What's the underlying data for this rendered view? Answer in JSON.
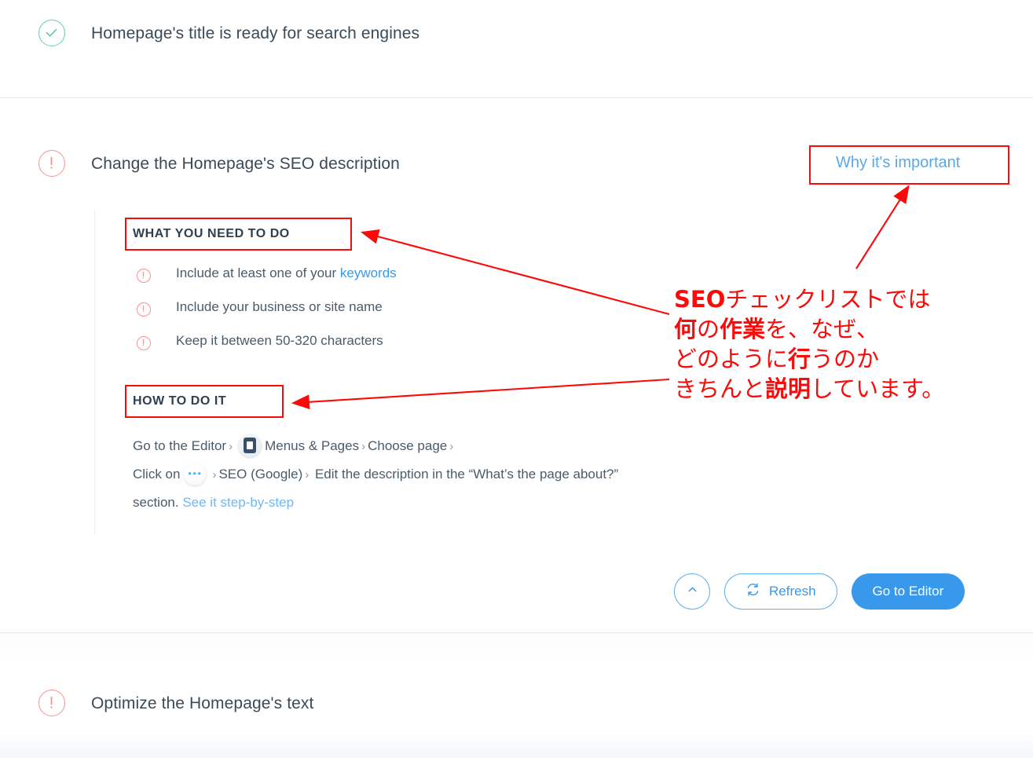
{
  "colors": {
    "accent_blue": "#3899ec",
    "link_blue": "#74b7f0",
    "ok_green": "#64cfa0",
    "alert_pink": "#f79294",
    "annotation_red": "#fb0a0a",
    "text_dark": "#3b4a57",
    "text_body": "#4a5b69",
    "divider": "#e8ecef"
  },
  "rows": [
    {
      "id": "homepage-title",
      "status_icon": "check-circle-icon",
      "status": "ok",
      "title": "Homepage's title is ready for search engines"
    },
    {
      "id": "seo-description",
      "status_icon": "alert-circle-icon",
      "status": "alert",
      "title": "Change the Homepage's SEO description",
      "why_link": "Why it's important"
    },
    {
      "id": "homepage-text",
      "status_icon": "alert-circle-icon",
      "status": "alert",
      "title": "Optimize the Homepage's text"
    }
  ],
  "detail": {
    "heading_what": "WHAT YOU NEED TO DO",
    "heading_how": "HOW TO DO IT",
    "checklist": [
      {
        "icon": "alert-circle-icon",
        "text_before": "Include at least one of your ",
        "link": "keywords",
        "text_after": ""
      },
      {
        "icon": "alert-circle-icon",
        "text_before": "Include your business or site name",
        "link": "",
        "text_after": ""
      },
      {
        "icon": "alert-circle-icon",
        "text_before": "Keep it between 50-320 characters",
        "link": "",
        "text_after": ""
      }
    ],
    "howto": {
      "part1": "Go to the Editor",
      "chev1": "›",
      "icon1": "menus-and-pages-icon",
      "part2": "Menus & Pages",
      "chev2": "›",
      "part3": "Choose page",
      "chev3": "›",
      "part4": "Click on",
      "icon2": "more-actions-dots-icon",
      "chev4": "›",
      "part5": "SEO (Google)",
      "chev5": "›",
      "part6": "Edit the description in the “What’s the page about?” section.",
      "link": "See it step-by-step"
    }
  },
  "actions": {
    "collapse_icon": "chevron-up-icon",
    "refresh_icon": "refresh-icon",
    "refresh_label": "Refresh",
    "primary_label": "Go to Editor"
  },
  "annotation": {
    "lines": [
      {
        "segments": [
          {
            "text": "SEO",
            "bold": true
          },
          {
            "text": "チェックリストでは",
            "bold": false
          }
        ]
      },
      {
        "segments": [
          {
            "text": "何",
            "bold": true
          },
          {
            "text": "の",
            "bold": false
          },
          {
            "text": "作業",
            "bold": true
          },
          {
            "text": "を、なぜ、",
            "bold": false
          }
        ]
      },
      {
        "segments": [
          {
            "text": "どのように",
            "bold": false
          },
          {
            "text": "行",
            "bold": true
          },
          {
            "text": "うのか",
            "bold": false
          }
        ]
      },
      {
        "segments": [
          {
            "text": "きちんと",
            "bold": false
          },
          {
            "text": "説明",
            "bold": true
          },
          {
            "text": "しています。",
            "bold": false
          }
        ]
      }
    ]
  }
}
